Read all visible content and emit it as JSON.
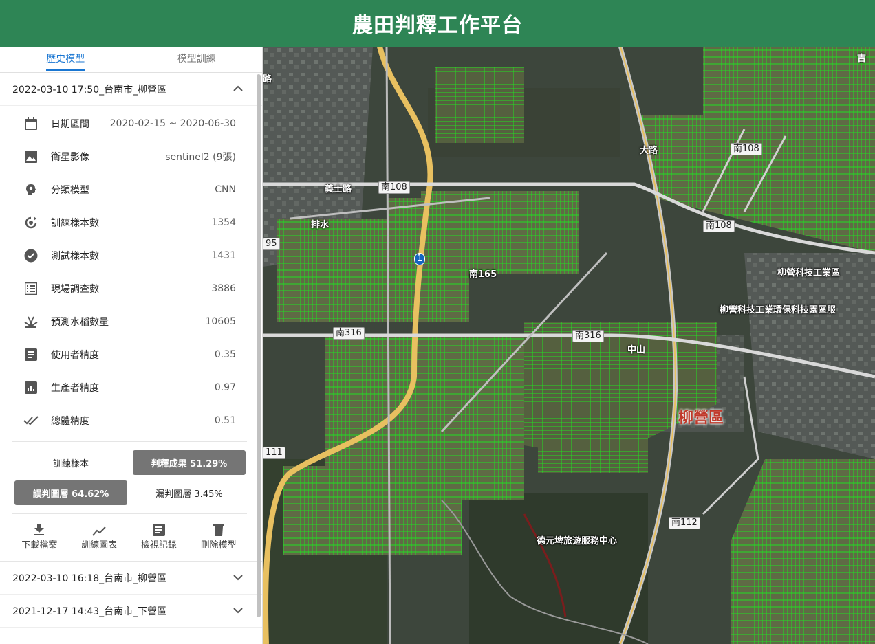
{
  "header": {
    "title": "農田判釋工作平台"
  },
  "tabs": [
    {
      "label": "歷史模型"
    },
    {
      "label": "模型訓練"
    }
  ],
  "records": [
    {
      "title": "2022-03-10 17:50_台南市_柳營區"
    },
    {
      "title": "2022-03-10 16:18_台南市_柳營區"
    },
    {
      "title": "2021-12-17 14:43_台南市_下營區"
    }
  ],
  "details": [
    {
      "icon": "calendar-icon",
      "label": "日期區間",
      "value": "2020-02-15 ~ 2020-06-30"
    },
    {
      "icon": "image-icon",
      "label": "衛星影像",
      "value": "sentinel2 (9張)"
    },
    {
      "icon": "model-icon",
      "label": "分類模型",
      "value": "CNN"
    },
    {
      "icon": "training-icon",
      "label": "訓練樣本數",
      "value": "1354"
    },
    {
      "icon": "check-circle-icon",
      "label": "測試樣本數",
      "value": "1431"
    },
    {
      "icon": "list-icon",
      "label": "現場調查數",
      "value": "3886"
    },
    {
      "icon": "rice-icon",
      "label": "預測水稻數量",
      "value": "10605"
    },
    {
      "icon": "document-icon",
      "label": "使用者精度",
      "value": "0.35"
    },
    {
      "icon": "bar-chart-icon",
      "label": "生產者精度",
      "value": "0.97"
    },
    {
      "icon": "double-check-icon",
      "label": "總體精度",
      "value": "0.51"
    }
  ],
  "layers": {
    "training_sample": "訓練樣本",
    "result": "判釋成果 51.29%",
    "misclassified": "誤判圖層 64.62%",
    "omission": "漏判圖層 3.45%"
  },
  "actions": [
    {
      "icon": "download-icon",
      "label": "下載檔案"
    },
    {
      "icon": "line-chart-icon",
      "label": "訓練圖表"
    },
    {
      "icon": "log-icon",
      "label": "檢視記錄"
    },
    {
      "icon": "trash-icon",
      "label": "刪除模型"
    }
  ],
  "map": {
    "labels": {
      "yishi_rd": "義士路",
      "nan108_a": "南108",
      "nan108_b": "南108",
      "nan108_c": "南108",
      "nan316_a": "南316",
      "nan316_b": "南316",
      "nan112": "南112",
      "route1": "1",
      "route95": "95",
      "route111": "111",
      "district": "柳營區",
      "industrial_park": "柳營科技工業區",
      "eco_park": "柳營科技工業環保科技園區服",
      "visitor_center": "德元埤旅遊服務中心",
      "drain": "排水",
      "zhongshan": "中山",
      "dalu": "大路",
      "nan165": "南165",
      "lu_a": "路",
      "ji": "吉"
    }
  }
}
